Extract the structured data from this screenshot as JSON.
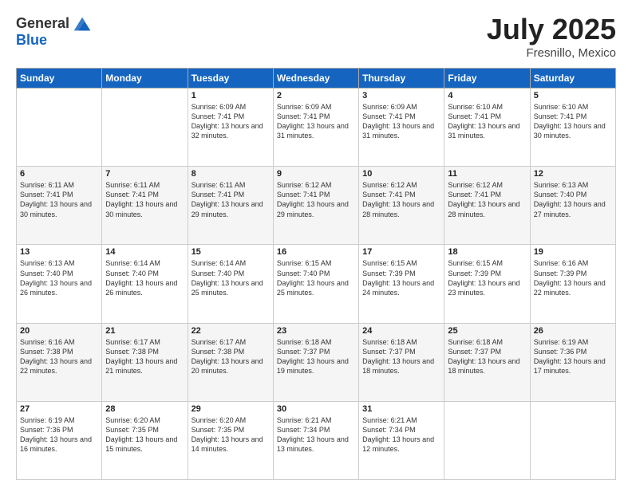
{
  "header": {
    "logo_general": "General",
    "logo_blue": "Blue",
    "title": "July 2025",
    "location": "Fresnillo, Mexico"
  },
  "days_of_week": [
    "Sunday",
    "Monday",
    "Tuesday",
    "Wednesday",
    "Thursday",
    "Friday",
    "Saturday"
  ],
  "weeks": [
    [
      {
        "day": "",
        "info": ""
      },
      {
        "day": "",
        "info": ""
      },
      {
        "day": "1",
        "info": "Sunrise: 6:09 AM\nSunset: 7:41 PM\nDaylight: 13 hours and 32 minutes."
      },
      {
        "day": "2",
        "info": "Sunrise: 6:09 AM\nSunset: 7:41 PM\nDaylight: 13 hours and 31 minutes."
      },
      {
        "day": "3",
        "info": "Sunrise: 6:09 AM\nSunset: 7:41 PM\nDaylight: 13 hours and 31 minutes."
      },
      {
        "day": "4",
        "info": "Sunrise: 6:10 AM\nSunset: 7:41 PM\nDaylight: 13 hours and 31 minutes."
      },
      {
        "day": "5",
        "info": "Sunrise: 6:10 AM\nSunset: 7:41 PM\nDaylight: 13 hours and 30 minutes."
      }
    ],
    [
      {
        "day": "6",
        "info": "Sunrise: 6:11 AM\nSunset: 7:41 PM\nDaylight: 13 hours and 30 minutes."
      },
      {
        "day": "7",
        "info": "Sunrise: 6:11 AM\nSunset: 7:41 PM\nDaylight: 13 hours and 30 minutes."
      },
      {
        "day": "8",
        "info": "Sunrise: 6:11 AM\nSunset: 7:41 PM\nDaylight: 13 hours and 29 minutes."
      },
      {
        "day": "9",
        "info": "Sunrise: 6:12 AM\nSunset: 7:41 PM\nDaylight: 13 hours and 29 minutes."
      },
      {
        "day": "10",
        "info": "Sunrise: 6:12 AM\nSunset: 7:41 PM\nDaylight: 13 hours and 28 minutes."
      },
      {
        "day": "11",
        "info": "Sunrise: 6:12 AM\nSunset: 7:41 PM\nDaylight: 13 hours and 28 minutes."
      },
      {
        "day": "12",
        "info": "Sunrise: 6:13 AM\nSunset: 7:40 PM\nDaylight: 13 hours and 27 minutes."
      }
    ],
    [
      {
        "day": "13",
        "info": "Sunrise: 6:13 AM\nSunset: 7:40 PM\nDaylight: 13 hours and 26 minutes."
      },
      {
        "day": "14",
        "info": "Sunrise: 6:14 AM\nSunset: 7:40 PM\nDaylight: 13 hours and 26 minutes."
      },
      {
        "day": "15",
        "info": "Sunrise: 6:14 AM\nSunset: 7:40 PM\nDaylight: 13 hours and 25 minutes."
      },
      {
        "day": "16",
        "info": "Sunrise: 6:15 AM\nSunset: 7:40 PM\nDaylight: 13 hours and 25 minutes."
      },
      {
        "day": "17",
        "info": "Sunrise: 6:15 AM\nSunset: 7:39 PM\nDaylight: 13 hours and 24 minutes."
      },
      {
        "day": "18",
        "info": "Sunrise: 6:15 AM\nSunset: 7:39 PM\nDaylight: 13 hours and 23 minutes."
      },
      {
        "day": "19",
        "info": "Sunrise: 6:16 AM\nSunset: 7:39 PM\nDaylight: 13 hours and 22 minutes."
      }
    ],
    [
      {
        "day": "20",
        "info": "Sunrise: 6:16 AM\nSunset: 7:38 PM\nDaylight: 13 hours and 22 minutes."
      },
      {
        "day": "21",
        "info": "Sunrise: 6:17 AM\nSunset: 7:38 PM\nDaylight: 13 hours and 21 minutes."
      },
      {
        "day": "22",
        "info": "Sunrise: 6:17 AM\nSunset: 7:38 PM\nDaylight: 13 hours and 20 minutes."
      },
      {
        "day": "23",
        "info": "Sunrise: 6:18 AM\nSunset: 7:37 PM\nDaylight: 13 hours and 19 minutes."
      },
      {
        "day": "24",
        "info": "Sunrise: 6:18 AM\nSunset: 7:37 PM\nDaylight: 13 hours and 18 minutes."
      },
      {
        "day": "25",
        "info": "Sunrise: 6:18 AM\nSunset: 7:37 PM\nDaylight: 13 hours and 18 minutes."
      },
      {
        "day": "26",
        "info": "Sunrise: 6:19 AM\nSunset: 7:36 PM\nDaylight: 13 hours and 17 minutes."
      }
    ],
    [
      {
        "day": "27",
        "info": "Sunrise: 6:19 AM\nSunset: 7:36 PM\nDaylight: 13 hours and 16 minutes."
      },
      {
        "day": "28",
        "info": "Sunrise: 6:20 AM\nSunset: 7:35 PM\nDaylight: 13 hours and 15 minutes."
      },
      {
        "day": "29",
        "info": "Sunrise: 6:20 AM\nSunset: 7:35 PM\nDaylight: 13 hours and 14 minutes."
      },
      {
        "day": "30",
        "info": "Sunrise: 6:21 AM\nSunset: 7:34 PM\nDaylight: 13 hours and 13 minutes."
      },
      {
        "day": "31",
        "info": "Sunrise: 6:21 AM\nSunset: 7:34 PM\nDaylight: 13 hours and 12 minutes."
      },
      {
        "day": "",
        "info": ""
      },
      {
        "day": "",
        "info": ""
      }
    ]
  ]
}
